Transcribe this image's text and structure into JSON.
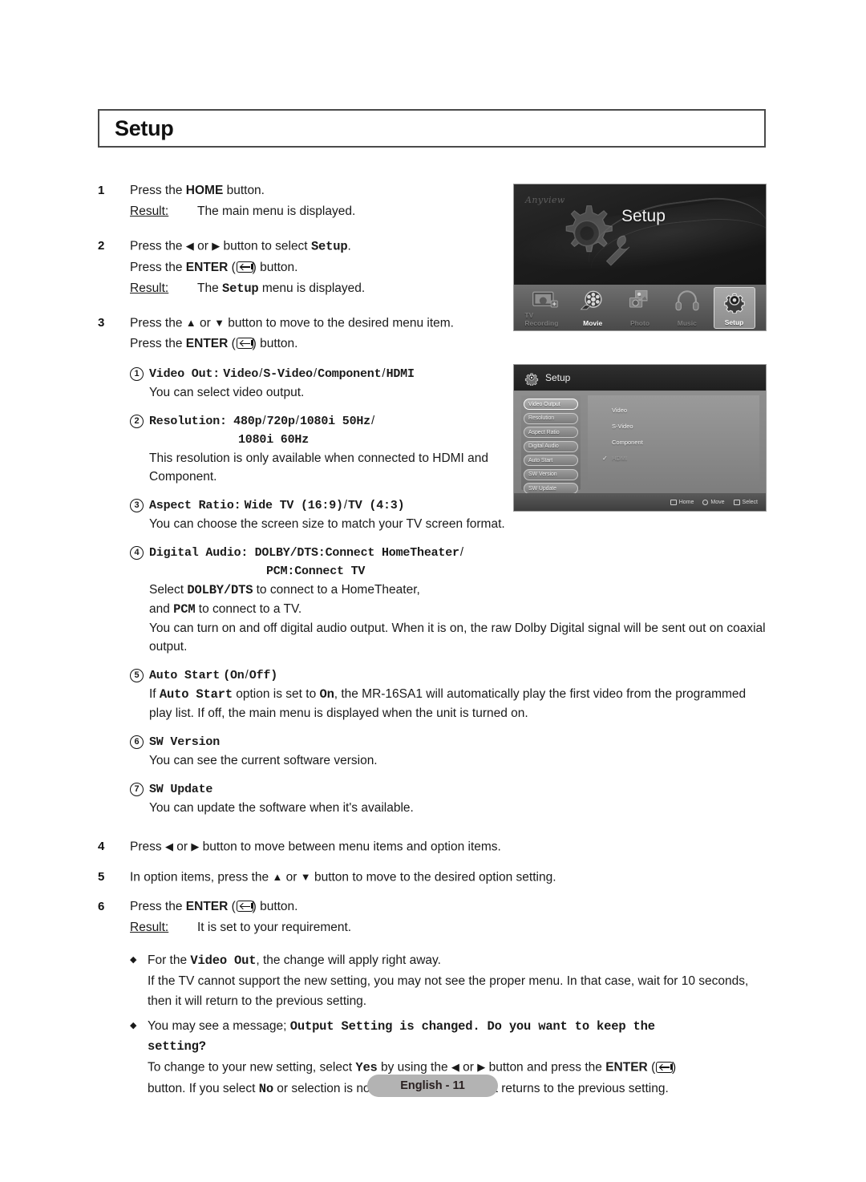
{
  "page": {
    "title": "Setup",
    "footer_label": "English - 11"
  },
  "steps": [
    {
      "num": "1",
      "line1_pre": "Press the ",
      "line1_bold": "HOME",
      "line1_post": " button.",
      "result_label": "Result:",
      "result_text": "The main menu is displayed."
    },
    {
      "num": "2",
      "line1_pre": "Press the ",
      "arrow_left": "◀",
      "line1_mid": " or ",
      "arrow_right": "▶",
      "line1_post": " button to select ",
      "line1_mono": "Setup",
      "line1_end": ".",
      "line2_pre": "Press the ",
      "line2_bold": "ENTER",
      "line2_post": " button.",
      "result_label": "Result:",
      "result_pre": "The ",
      "result_mono": "Setup",
      "result_post": " menu is displayed."
    },
    {
      "num": "3",
      "line1_pre": "Press the ",
      "arrow_up": "▲",
      "line1_mid": " or ",
      "arrow_down": "▼",
      "line1_post": " button to move to the desired menu item.",
      "line2_pre": "Press the ",
      "line2_bold": "ENTER",
      "line2_post": " button."
    }
  ],
  "menu_items": [
    {
      "n": "1",
      "label": "Video Out:",
      "options": [
        "Video",
        "S-Video",
        "Component",
        "HDMI"
      ],
      "desc": "You can select video output."
    },
    {
      "n": "2",
      "label": "Resolution:",
      "options": [
        "480p",
        "720p",
        "1080i 50Hz"
      ],
      "options_line2": [
        "1080i 60Hz"
      ],
      "desc": "This resolution is only available when connected to HDMI and Component."
    },
    {
      "n": "3",
      "label": "Aspect Ratio:",
      "options": [
        "Wide TV (16:9)",
        "TV (4:3)"
      ],
      "desc": "You can choose the screen size to match your TV screen format."
    },
    {
      "n": "4",
      "label": "Digital Audio:",
      "options": [
        "DOLBY/DTS:Connect HomeTheater"
      ],
      "options_line2": [
        "PCM:Connect TV"
      ],
      "desc_pre": "Select ",
      "desc_mono1": "DOLBY/DTS",
      "desc_mid": " to connect to a HomeTheater,",
      "desc_line2_pre": "and ",
      "desc_mono2": "PCM",
      "desc_line2_post": " to connect to a TV.",
      "desc_line3": "You can turn on and off digital audio output. When it is on, the raw Dolby Digital signal will be sent out on coaxial output."
    },
    {
      "n": "5",
      "label": "Auto Start",
      "options": [
        "On",
        "Off"
      ],
      "desc_pre": "If ",
      "desc_mono1": "Auto Start",
      "desc_mid": " option is set to ",
      "desc_mono2": "On",
      "desc_post": ", the MR-16SA1 will automatically play the first video from the programmed play list. If off, the main menu is displayed when the unit is turned on."
    },
    {
      "n": "6",
      "label": "SW Version",
      "desc": "You can see the current software version."
    },
    {
      "n": "7",
      "label": "SW Update",
      "desc": "You can update the software when it's available."
    }
  ],
  "steps_tail": [
    {
      "num": "4",
      "pre": "Press ",
      "arrow_left": "◀",
      "mid": " or ",
      "arrow_right": "▶",
      "post": " button to move between menu items and option items."
    },
    {
      "num": "5",
      "pre": "In option items, press the ",
      "arrow_up": "▲",
      "mid": " or ",
      "arrow_down": "▼",
      "post": " button to move to the desired option setting."
    },
    {
      "num": "6",
      "pre": "Press the ",
      "bold": "ENTER",
      "post": " button.",
      "result_label": "Result:",
      "result_text": "It is set to your requirement."
    }
  ],
  "bullets": [
    {
      "marker": "◆",
      "l1_pre": "For the ",
      "l1_mono": "Video Out",
      "l1_post": ", the change will apply right away.",
      "l2": "If the TV cannot support the new setting, you may not see the proper menu. In that case, wait for 10 seconds, then it will return to the previous setting."
    },
    {
      "marker": "◆",
      "l1_pre": "You may see a message; ",
      "l1_mono": "Output Setting is changed. Do you want to keep the",
      "l1_mono2": "setting?",
      "l2_pre": "To change to your new setting, select ",
      "l2_mono1": "Yes",
      "l2_mid": " by using the ",
      "arrow_left": "◀",
      "l2_mid2": " or ",
      "arrow_right": "▶",
      "l2_post": " button and press the ",
      "l2_bold": "ENTER",
      "l3_pre": "button. If you select ",
      "l3_mono": "No",
      "l3_post": " or selection is not done in 20 seconds, it returns to the previous setting."
    }
  ],
  "screenshot_main": {
    "logo": "Anyview",
    "title": "Setup",
    "nav": [
      {
        "label": "TV Recording",
        "icon": "tv-recording-icon",
        "state": "dim"
      },
      {
        "label": "Movie",
        "icon": "film-reel-icon",
        "state": "lit"
      },
      {
        "label": "Photo",
        "icon": "photo-icon",
        "state": "dim"
      },
      {
        "label": "Music",
        "icon": "headphones-icon",
        "state": "dim"
      },
      {
        "label": "Setup",
        "icon": "gear-icon",
        "state": "selected"
      }
    ]
  },
  "screenshot_setup": {
    "header_title": "Setup",
    "sidebar": [
      "Video Output",
      "Resolution",
      "Aspect Ratio",
      "Digital Audio",
      "Auto Start",
      "SW Version",
      "SW Update"
    ],
    "active_sidebar": "Video Output",
    "options": [
      "Video",
      "S-Video",
      "Component",
      "HDMI"
    ],
    "checked_option": "HDMI",
    "check_glyph": "✓",
    "footer": [
      {
        "icon": "home-box-icon",
        "label": "Home"
      },
      {
        "icon": "move-circle-icon",
        "label": "Move"
      },
      {
        "icon": "select-enter-icon",
        "label": "Select"
      }
    ]
  },
  "colors": {
    "title_border": "#4a4a4a",
    "footer_pill": "#b3b3b3",
    "text": "#1a1a1a"
  }
}
